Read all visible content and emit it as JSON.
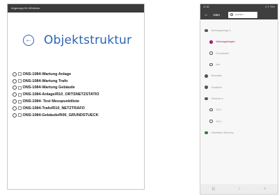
{
  "windows_app": {
    "title": "Angecapp für Windows",
    "page_title": "Objektstruktur",
    "tree_items": [
      "ONS-1084-Wartung Anlage",
      "ONS-1084-Wartung Trafo",
      "ONS-1084-Wartung Gebäude",
      "ONS-1084-Anlage/R10_ORTSNETZSTATIO",
      "ONS-1084- Test Messpunktliste",
      "ONS-1084-Trafo/R10_NETZTRAFO",
      "ONS-1084-Gebäude/R06_GRUNDSTUECK"
    ]
  },
  "android_app": {
    "status_time": "11:36",
    "status_right": "4 ✦ 76%",
    "back_glyph": "←",
    "title": "1084",
    "search_placeholder": "suchen",
    "tree_items": [
      {
        "label": "Wartungsanlage ▾",
        "dot": "outline-filled",
        "indent": 0,
        "caret": ""
      },
      {
        "label": "Wartungsanlagen",
        "dot": "pink",
        "indent": 1,
        "caret": ""
      },
      {
        "label": "Druckstufen",
        "dot": "outline",
        "indent": 1,
        "caret": ""
      },
      {
        "label": "Info",
        "dot": "outline",
        "indent": 1,
        "caret": ""
      },
      {
        "label": "Messtafel",
        "dot": "outline-filled",
        "indent": 0,
        "caret": ""
      },
      {
        "label": "Schaltfeld",
        "dot": "outline-filled",
        "indent": 0,
        "caret": ""
      },
      {
        "label": "Gebäude ▾",
        "dot": "outline-filled",
        "indent": 0,
        "caret": ""
      },
      {
        "label": "Teil 1",
        "dot": "outline",
        "indent": 1,
        "caret": ""
      },
      {
        "label": "Teil 2",
        "dot": "outline",
        "indent": 1,
        "caret": ""
      },
      {
        "label": "Installation Messung",
        "dot": "green",
        "indent": 0,
        "caret": ""
      }
    ],
    "nav": [
      "|||",
      "○",
      "<"
    ]
  },
  "colors": {
    "accent_blue": "#2b63b3",
    "titlebar_dark": "#3b3b3b",
    "selected_pink": "#a02070",
    "status_green": "#2e7d32"
  }
}
